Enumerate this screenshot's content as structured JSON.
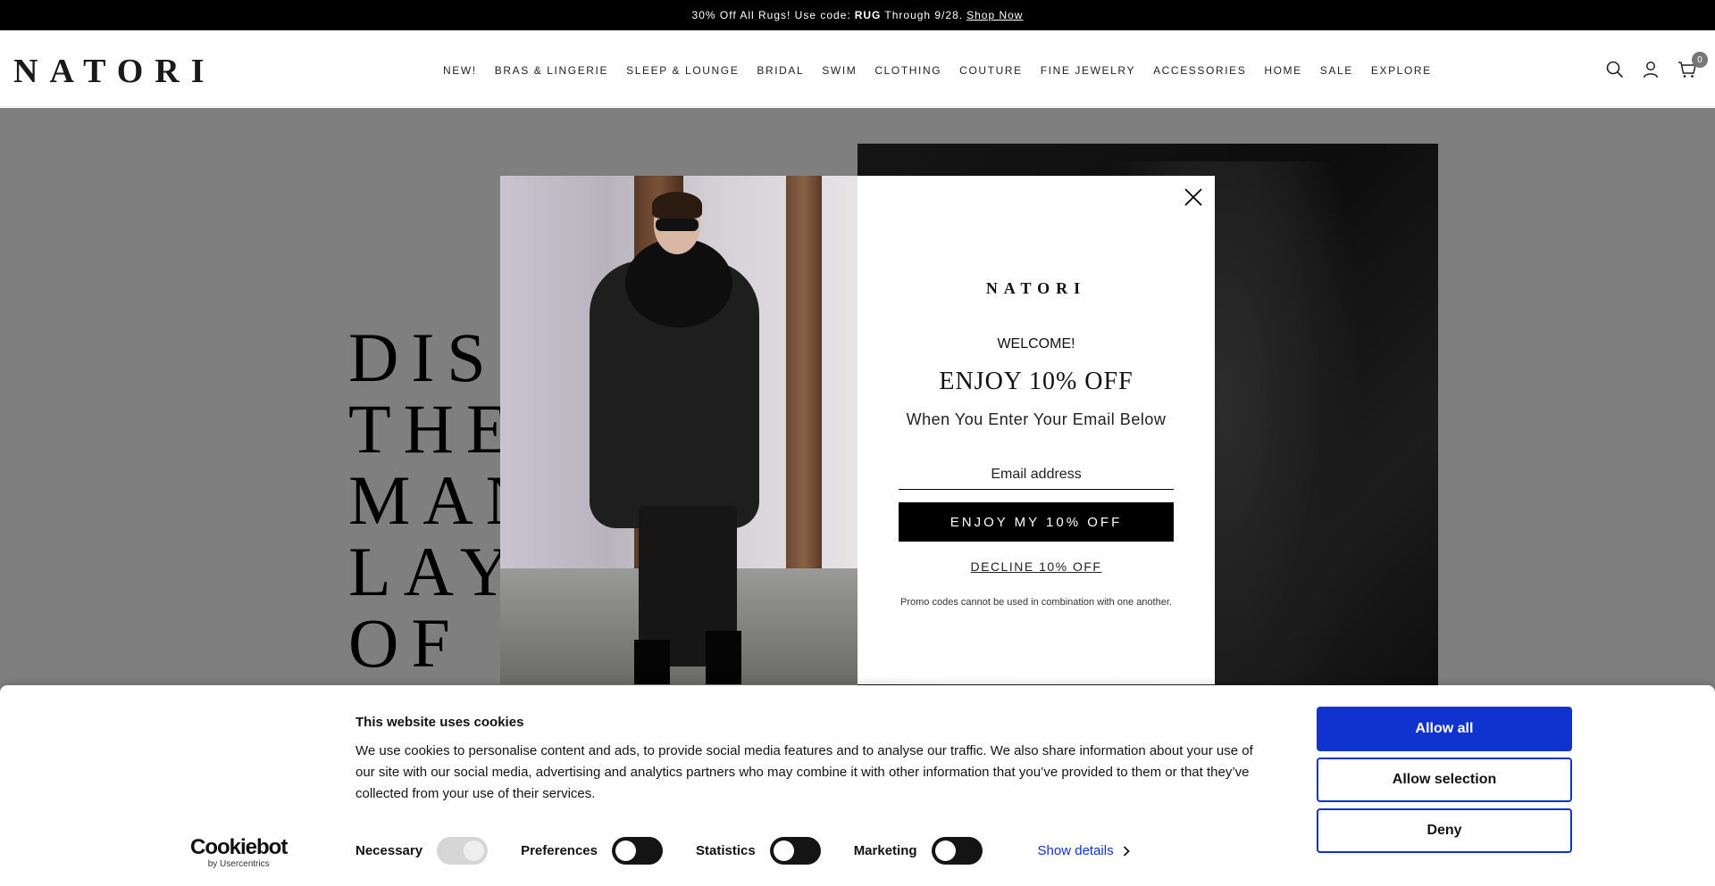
{
  "announcement": {
    "prefix": "30% Off All Rugs! Use code:",
    "code": "RUG",
    "suffix": "Through 9/28.",
    "link": "Shop Now"
  },
  "header": {
    "logo": "NATORI",
    "nav": [
      "NEW!",
      "BRAS & LINGERIE",
      "SLEEP & LOUNGE",
      "BRIDAL",
      "SWIM",
      "CLOTHING",
      "COUTURE",
      "FINE JEWELRY",
      "ACCESSORIES",
      "HOME",
      "SALE",
      "EXPLORE"
    ],
    "icons": [
      "search-icon",
      "account-icon",
      "cart-icon"
    ],
    "cart_count": "0"
  },
  "hero": {
    "lines": [
      "DISC",
      "THE",
      "MAN",
      "LAY",
      "OF"
    ]
  },
  "modal": {
    "logo": "NATORI",
    "welcome": "WELCOME!",
    "headline": "ENJOY 10% OFF",
    "subhead": "When You Enter Your Email Below",
    "email_placeholder": "Email address",
    "submit": "ENJOY MY 10% OFF",
    "decline": "DECLINE 10% OFF",
    "note": "Promo codes cannot be used in combination with one another."
  },
  "cookie": {
    "title": "This website uses cookies",
    "text": "We use cookies to personalise content and ads, to provide social media features and to analyse our traffic. We also share information about your use of our site with our social media, advertising and analytics partners who may combine it with other information that you’ve provided to them or that they’ve collected from your use of their services.",
    "logo_main": "Cookiebot",
    "logo_by": "by Usercentrics",
    "toggles": [
      {
        "label": "Necessary",
        "state": "disabled-on"
      },
      {
        "label": "Preferences",
        "state": "off"
      },
      {
        "label": "Statistics",
        "state": "off"
      },
      {
        "label": "Marketing",
        "state": "off"
      }
    ],
    "show_details": "Show details",
    "buttons": {
      "allow_all": "Allow all",
      "allow_selection": "Allow selection",
      "deny": "Deny"
    },
    "accent_color": "#1032cf"
  }
}
